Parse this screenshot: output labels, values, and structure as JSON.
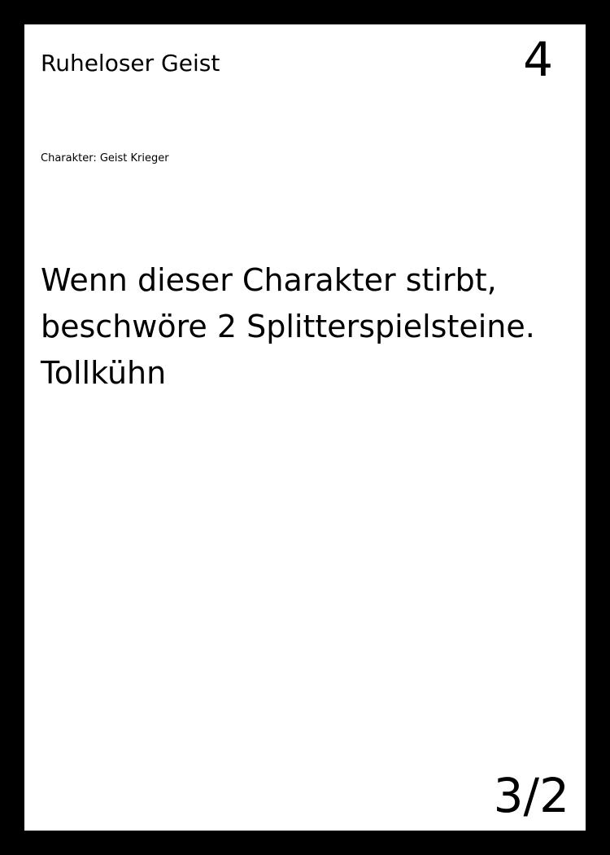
{
  "card": {
    "name": "Ruheloser Geist",
    "cost": "4",
    "type_line": "Charakter: Geist Krieger",
    "text_lines": [
      "Wenn dieser Charakter stirbt,",
      "beschwöre 2 Splitterspielsteine.",
      "Tollkühn"
    ],
    "stats": "3/2",
    "colors": {
      "border": "#000000",
      "face": "#ffffff",
      "text": "#000000"
    }
  }
}
